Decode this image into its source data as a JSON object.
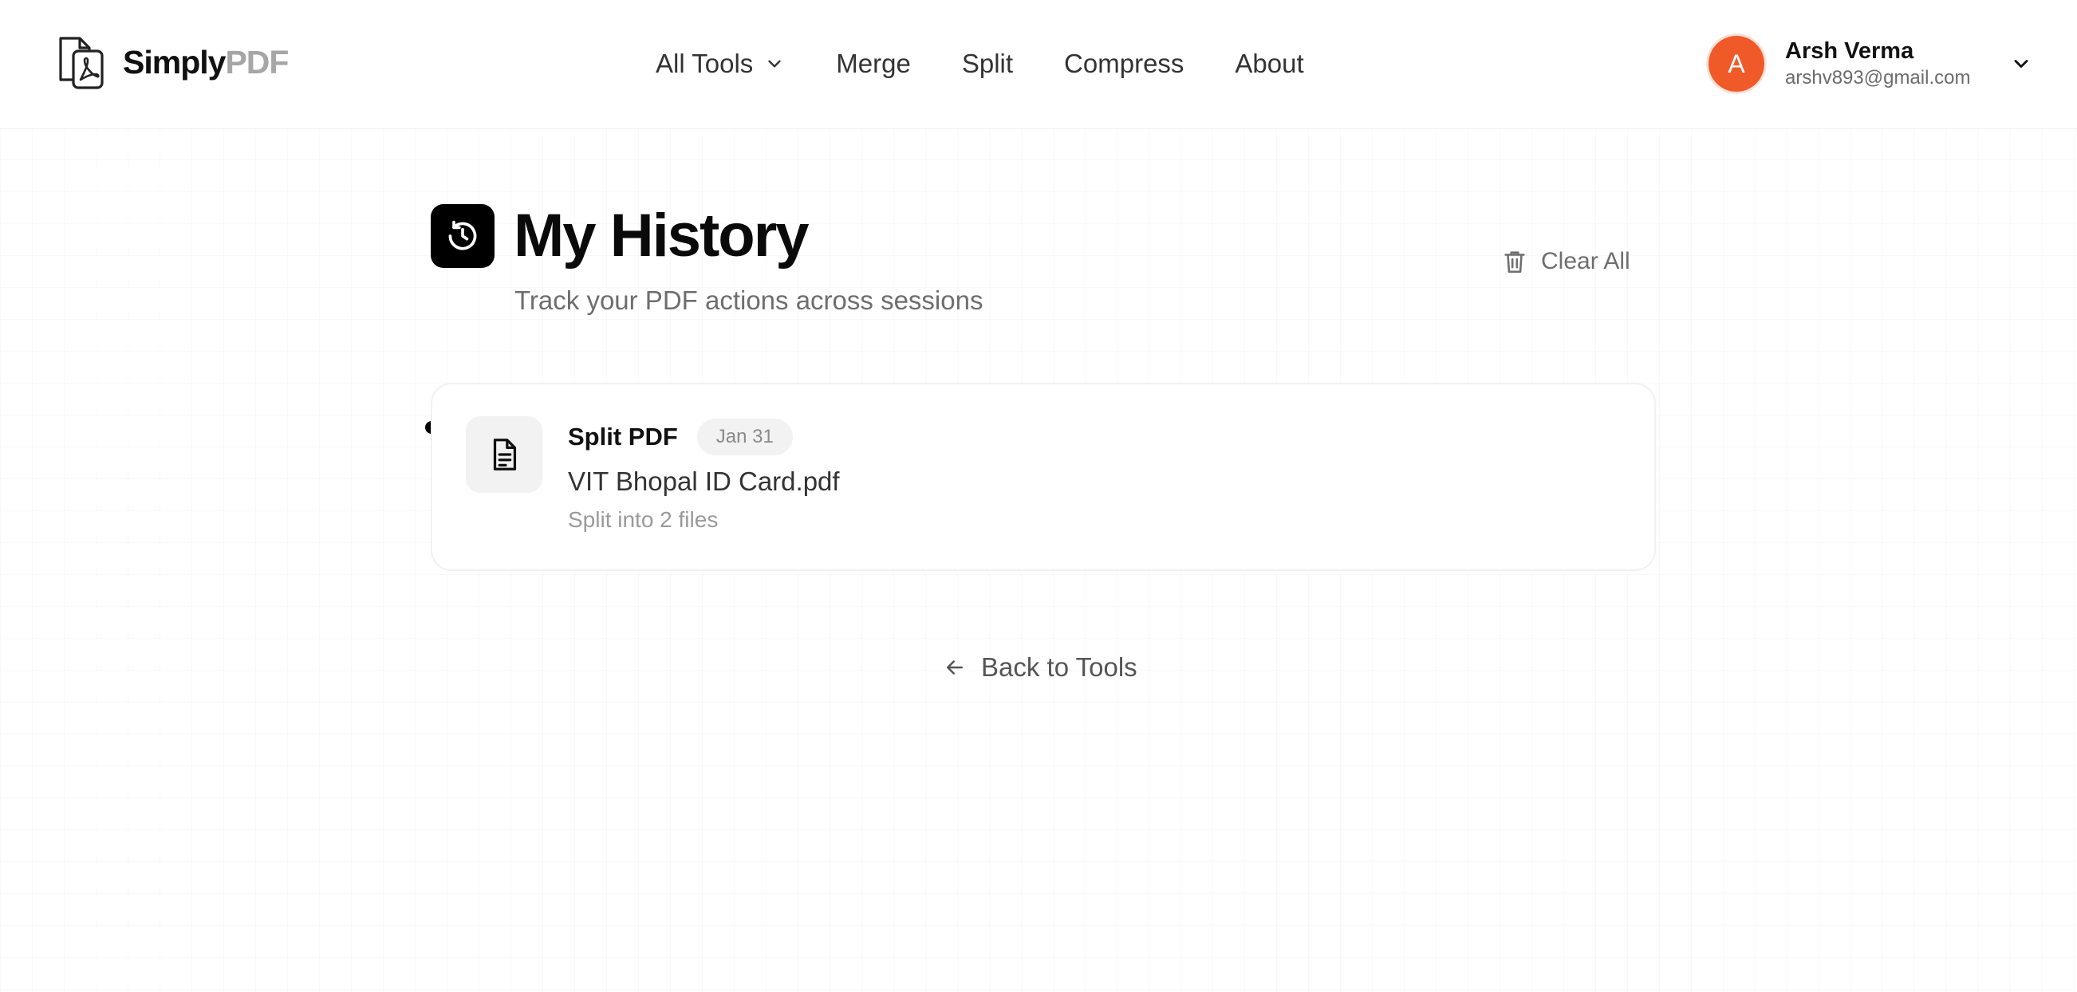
{
  "header": {
    "logo": {
      "primary": "Simply",
      "accent": "PDF",
      "icon": "pdf-document-icon"
    },
    "nav": [
      {
        "label": "All Tools",
        "has_dropdown": true
      },
      {
        "label": "Merge"
      },
      {
        "label": "Split"
      },
      {
        "label": "Compress"
      },
      {
        "label": "About"
      }
    ],
    "user": {
      "initial": "A",
      "name": "Arsh Verma",
      "email": "arshv893@gmail.com",
      "avatar_color": "#f05a28"
    }
  },
  "main": {
    "title": "My History",
    "title_icon": "history-icon",
    "subtitle": "Track your PDF actions across sessions",
    "clear_all_label": "Clear All",
    "history": [
      {
        "action": "Split PDF",
        "date": "Jan 31",
        "file_name": "VIT Bhopal ID Card.pdf",
        "detail": "Split into 2 files",
        "icon": "file-text-icon"
      }
    ],
    "back_label": "Back to Tools"
  },
  "colors": {
    "accent": "#000000",
    "avatar": "#f05a28",
    "muted_text": "#6e6e6e",
    "logo_accent": "#a6a6a6"
  }
}
